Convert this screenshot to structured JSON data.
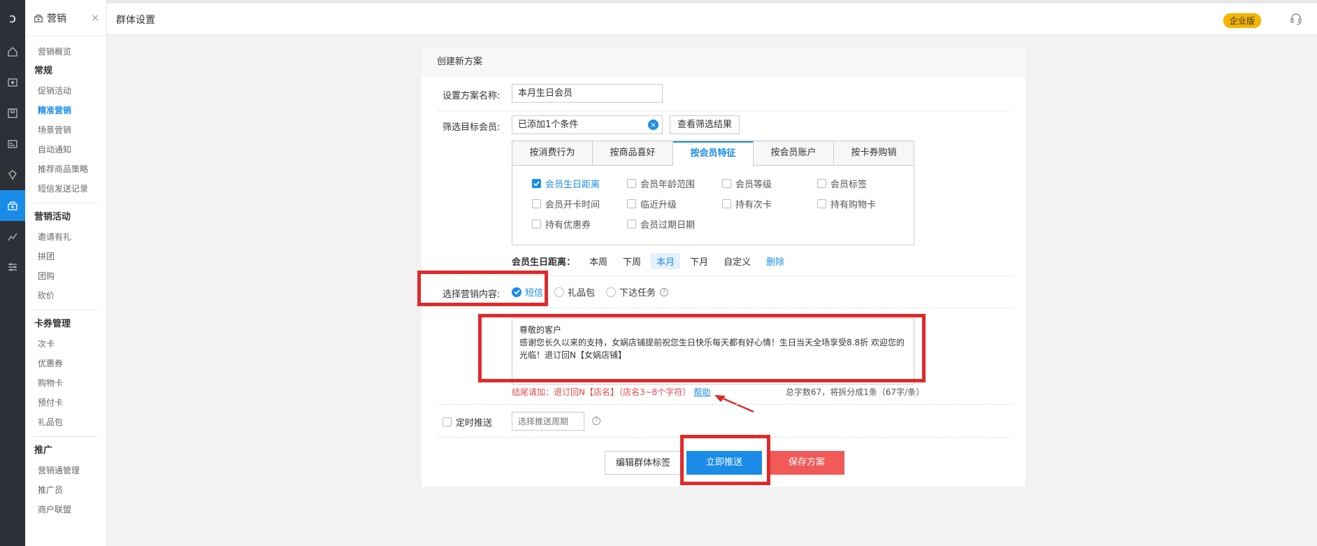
{
  "rail": {
    "logo": "ↄ",
    "icons": [
      "home-icon",
      "shop-icon",
      "package-icon",
      "id-card-icon",
      "tag-icon",
      "marketing-icon",
      "chart-icon",
      "settings-icon"
    ],
    "active_index": 5
  },
  "menu": {
    "title": "营销",
    "close": "×",
    "overview": "营销概览",
    "sections": [
      {
        "title": "常规",
        "items": [
          "促销活动",
          "精准营销",
          "场景营销",
          "自动通知",
          "推荐商品策略",
          "短信发送记录"
        ]
      },
      {
        "title": "营销活动",
        "items": [
          "邀请有礼",
          "拼团",
          "团购",
          "砍价"
        ]
      },
      {
        "title": "卡券管理",
        "items": [
          "次卡",
          "优惠券",
          "购物卡",
          "预付卡",
          "礼品包"
        ]
      },
      {
        "title": "推广",
        "items": [
          "营销通管理",
          "推广员",
          "商户联盟"
        ]
      }
    ],
    "active_item": "精准营销"
  },
  "topbar": {
    "title": "群体设置",
    "badge": "企业版"
  },
  "panel": {
    "header": "创建新方案",
    "name_label": "设置方案名称:",
    "name_value": "本月生日会员",
    "filter_label": "筛选目标会员:",
    "filter_value": "已添加1个条件",
    "view_results": "查看筛选结果",
    "tabs": [
      "按消费行为",
      "按商品喜好",
      "按会员特征",
      "按会员账户",
      "按卡券购销"
    ],
    "active_tab": 2,
    "checks": [
      {
        "label": "会员生日距离",
        "checked": true
      },
      {
        "label": "会员年龄范围",
        "checked": false
      },
      {
        "label": "会员等级",
        "checked": false
      },
      {
        "label": "会员标签",
        "checked": false
      },
      {
        "label": "会员开卡时间",
        "checked": false
      },
      {
        "label": "临近升级",
        "checked": false
      },
      {
        "label": "持有次卡",
        "checked": false
      },
      {
        "label": "持有购物卡",
        "checked": false
      },
      {
        "label": "持有优惠券",
        "checked": false
      },
      {
        "label": "会员过期日期",
        "checked": false
      }
    ],
    "birthday_label": "会员生日距离：",
    "birthday_opts": [
      "本周",
      "下周",
      "本月",
      "下月",
      "自定义"
    ],
    "birthday_selected": 2,
    "delete": "删除",
    "content_label": "选择营销内容:",
    "content_opts": [
      {
        "label": "短信",
        "checked": true
      },
      {
        "label": "礼品包",
        "checked": false
      },
      {
        "label": "下达任务",
        "checked": false
      }
    ],
    "message_lines": [
      "尊敬的客户",
      "感谢您长久以来的支持，女娲店铺提前祝您生日快乐每天都有好心情！生日当天全场享受8.8折 欢迎您的光临！退订回N【女娲店铺】"
    ],
    "tail_note": "结尾请加：退订回N【店名】（店名3~8个字符）",
    "help": "帮助",
    "char_count": "总字数67，将拆分成1条（67字/条）",
    "schedule_label": "定时推送",
    "schedule_placeholder": "选择推送周期",
    "buttons": {
      "edit_tags": "编辑群体标签",
      "push_now": "立即推送",
      "save": "保存方案"
    }
  },
  "colors": {
    "accent": "#1a8ce8",
    "danger": "#f25a5a",
    "highlight": "#e02a2a",
    "badge": "#f5b400"
  }
}
